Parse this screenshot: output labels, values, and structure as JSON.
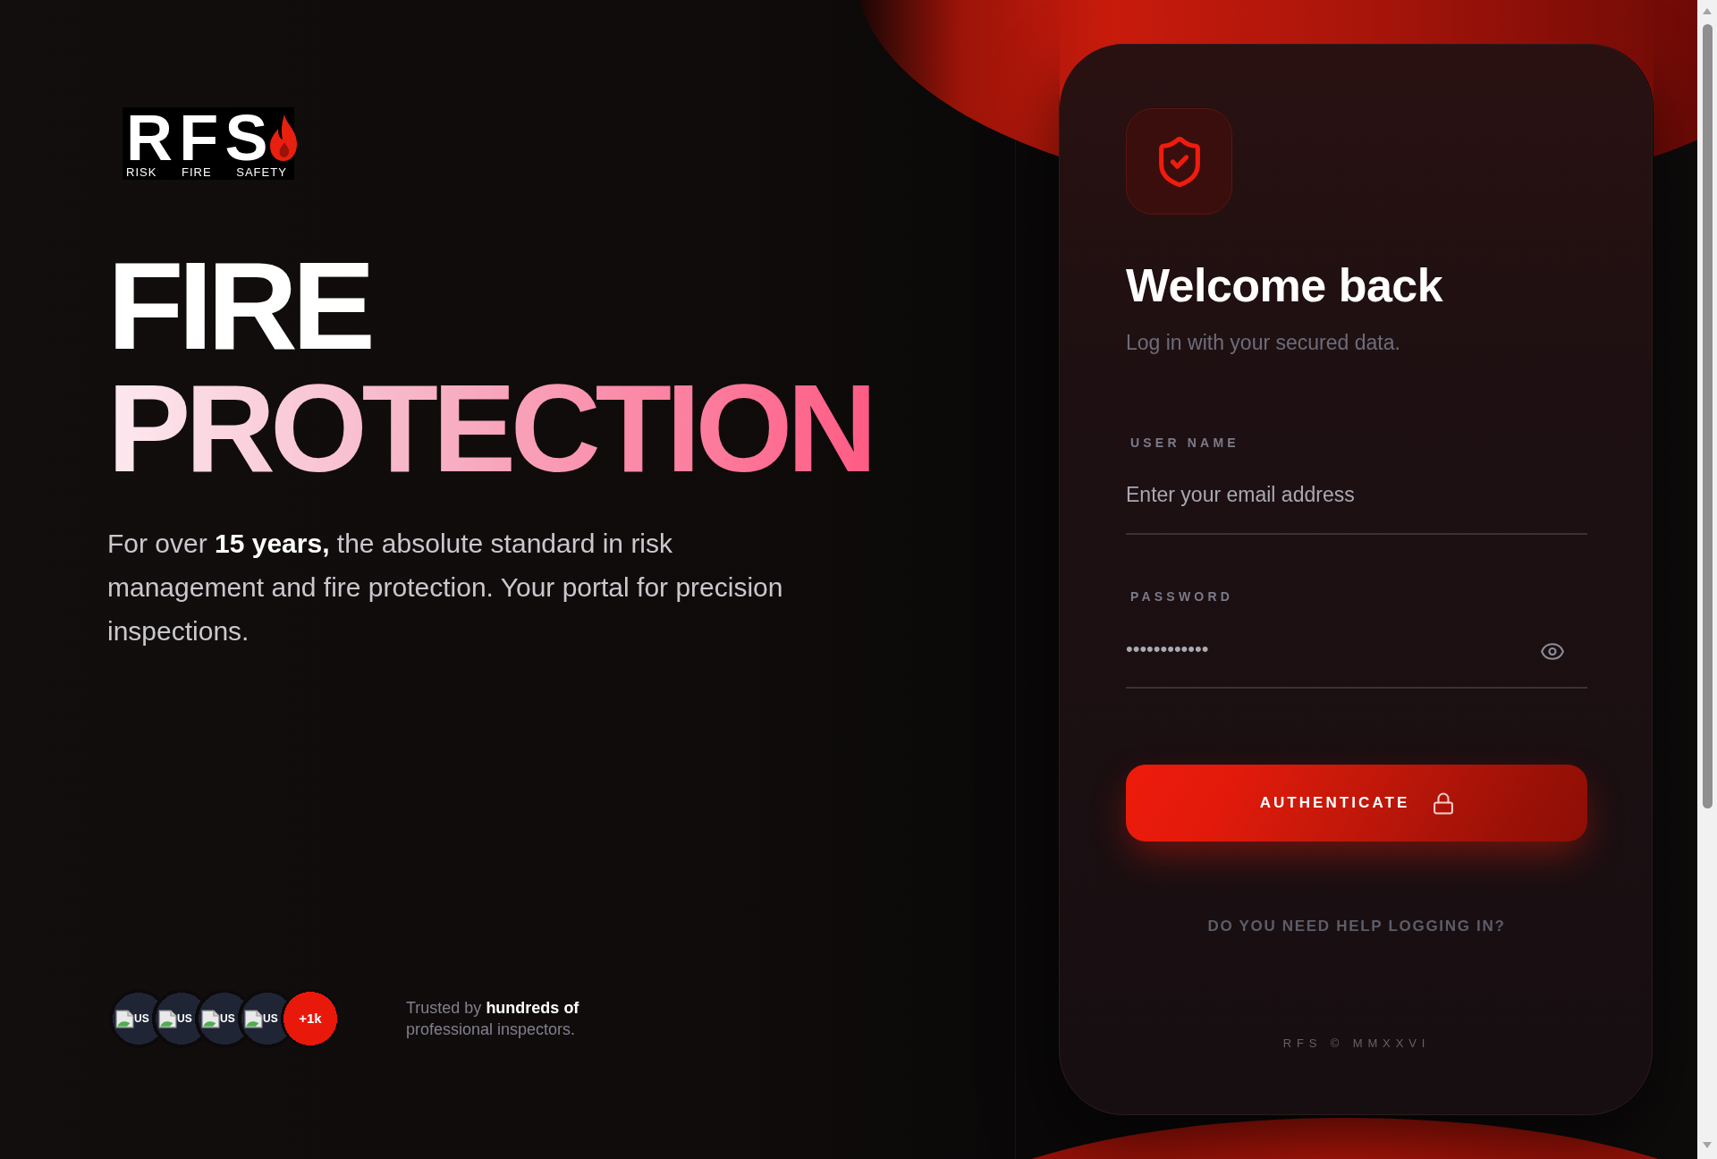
{
  "brand": {
    "wordmark": "RFS",
    "tagline": [
      "RISK",
      "FIRE",
      "SAFETY"
    ]
  },
  "hero": {
    "headline": [
      {
        "text": "FIRE",
        "kind": "solid"
      },
      {
        "text": "PROTECTION",
        "kind": "gradient"
      }
    ],
    "description": "For over **15 years,** the absolute standard in risk management and fire protection. Your portal for precision inspections."
  },
  "social_proof": {
    "avatars": [
      {
        "alt_text": "US"
      },
      {
        "alt_text": "US"
      },
      {
        "alt_text": "US"
      },
      {
        "alt_text": "US"
      }
    ],
    "more_count": "+1k",
    "caption": "Trusted by **hundreds of** professional inspectors."
  },
  "login_card": {
    "title": "Welcome back",
    "subtitle": "Log in with your secured data.",
    "fields": [
      {
        "kind": "text",
        "label": "USER NAME",
        "placeholder": "Enter your email address"
      },
      {
        "kind": "password",
        "label": "PASSWORD",
        "value": "••••••••••••"
      }
    ],
    "submit_button": "AUTHENTICATE",
    "help_link": "DO YOU NEED HELP LOGGING IN?",
    "footer": "RFS © MMXXVI"
  }
}
